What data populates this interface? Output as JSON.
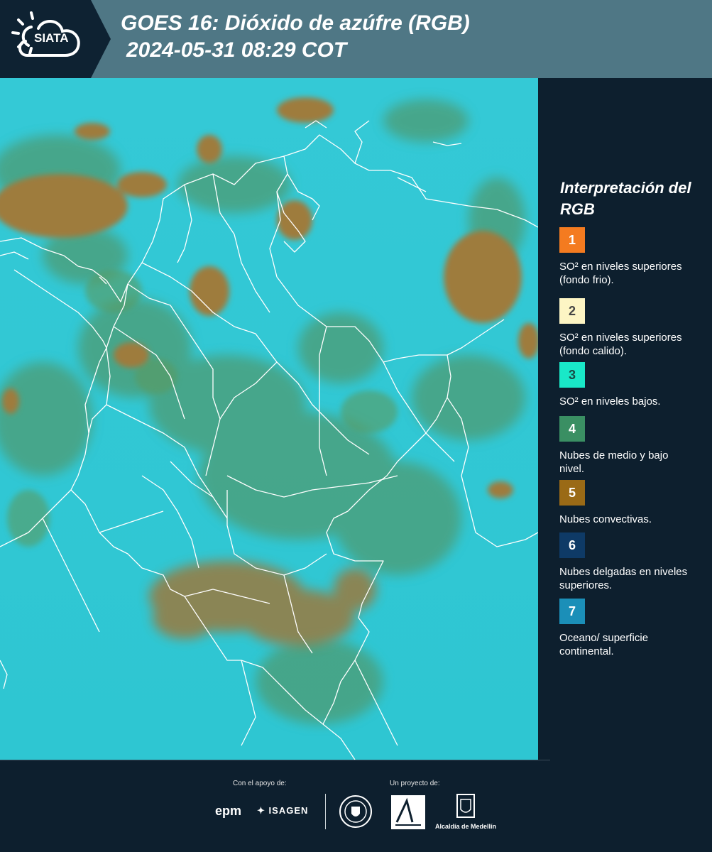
{
  "header": {
    "logo_text": "SIATA",
    "title_line1": "GOES 16: Dióxido de azúfre (RGB)",
    "title_line2": "2024-05-31 08:29 COT"
  },
  "legend": {
    "title": "Interpretación del RGB",
    "items": [
      {
        "number": "1",
        "color": "#f47b20",
        "text_color": "#ffffff",
        "label": "SO² en niveles superiores (fondo frio)."
      },
      {
        "number": "2",
        "color": "#fdf5c4",
        "text_color": "#444444",
        "label": "SO² en niveles superiores (fondo calido)."
      },
      {
        "number": "3",
        "color": "#19e8c8",
        "text_color": "#1a4a44",
        "label": "SO² en niveles bajos."
      },
      {
        "number": "4",
        "color": "#3a8f63",
        "text_color": "#ffffff",
        "label": "Nubes de medio y bajo nivel."
      },
      {
        "number": "5",
        "color": "#9a6a16",
        "text_color": "#ffffff",
        "label": "Nubes convectivas."
      },
      {
        "number": "6",
        "color": "#0e3a66",
        "text_color": "#ffffff",
        "label": "Nubes delgadas en niveles superiores."
      },
      {
        "number": "7",
        "color": "#1b8fb8",
        "text_color": "#ffffff",
        "label": "Oceano/ superficie continental."
      }
    ]
  },
  "footer": {
    "support_label": "Con el apoyo de:",
    "project_label": "Un proyecto de:",
    "sponsor1": "epm",
    "sponsor2": "ISAGEN",
    "partner": "Alcaldía de Medellín"
  },
  "colors": {
    "header_bg": "#4f7785",
    "panel_bg": "#0d1f2e",
    "map_base": "#2cc7d3",
    "cloud_green": "#4f9a6a",
    "cloud_brown": "#9a7a3c"
  }
}
